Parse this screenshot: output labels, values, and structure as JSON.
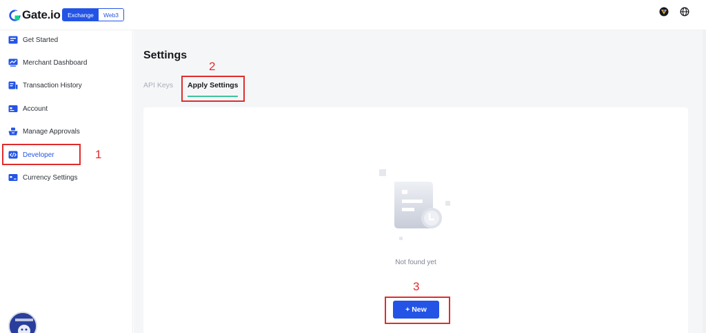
{
  "header": {
    "logo_text": "Gate.io",
    "switch": {
      "exchange": "Exchange",
      "web3": "Web3"
    },
    "icons": [
      "wallet-badge-icon",
      "globe-icon"
    ]
  },
  "sidebar": {
    "items": [
      {
        "label": "Get Started",
        "icon": "get-started-icon",
        "active": false
      },
      {
        "label": "Merchant Dashboard",
        "icon": "dashboard-chart-icon",
        "active": false
      },
      {
        "label": "Transaction History",
        "icon": "transaction-history-icon",
        "active": false
      },
      {
        "label": "Account",
        "icon": "account-card-icon",
        "active": false
      },
      {
        "label": "Manage Approvals",
        "icon": "approvals-icon",
        "active": false
      },
      {
        "label": "Developer",
        "icon": "code-icon",
        "active": true
      },
      {
        "label": "Currency Settings",
        "icon": "currency-card-icon",
        "active": false
      }
    ]
  },
  "main": {
    "title": "Settings",
    "tabs": [
      {
        "label": "API Keys",
        "active": false
      },
      {
        "label": "Apply Settings",
        "active": true
      }
    ],
    "empty_state": {
      "text": "Not found yet"
    },
    "new_button": {
      "label": "+ New"
    }
  },
  "annotations": [
    "1",
    "2",
    "3"
  ],
  "colors": {
    "accent": "#2354e6",
    "tab_underline": "#3ec39a",
    "annotation": "#e02b2b",
    "page_bg": "#f5f6f8"
  }
}
